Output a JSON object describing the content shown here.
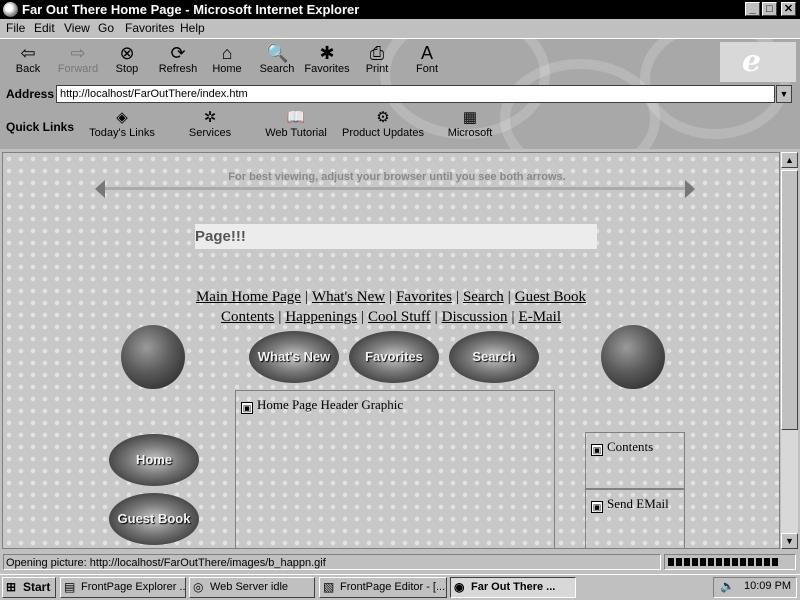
{
  "window": {
    "title": "Far Out There Home Page - Microsoft Internet Explorer",
    "controls": {
      "minimize": "_",
      "maximize": "□",
      "close": "✕"
    }
  },
  "menu": [
    "File",
    "Edit",
    "View",
    "Go",
    "Favorites",
    "Help"
  ],
  "toolbar": {
    "buttons": [
      {
        "label": "Back",
        "icon": "⇦"
      },
      {
        "label": "Forward",
        "icon": "⇨"
      },
      {
        "label": "Stop",
        "icon": "⊗"
      },
      {
        "label": "Refresh",
        "icon": "⟳"
      },
      {
        "label": "Home",
        "icon": "⌂"
      },
      {
        "label": "Search",
        "icon": "🔍"
      },
      {
        "label": "Favorites",
        "icon": "✱"
      },
      {
        "label": "Print",
        "icon": "⎙"
      },
      {
        "label": "Font",
        "icon": "A"
      }
    ],
    "logo": "e"
  },
  "address": {
    "label": "Address",
    "value": "http://localhost/FarOutThere/index.htm",
    "dropdown": "▼"
  },
  "quick_links": {
    "label": "Quick Links",
    "items": [
      {
        "label": "Today's Links",
        "icon": "◈"
      },
      {
        "label": "Services",
        "icon": "✲"
      },
      {
        "label": "Web Tutorial",
        "icon": "📖"
      },
      {
        "label": "Product Updates",
        "icon": "⚙"
      },
      {
        "label": "Microsoft",
        "icon": "▦"
      }
    ]
  },
  "page": {
    "best_view": "For best viewing, adjust your browser until you see both arrows.",
    "banner": "Page!!!",
    "nav_row1": [
      "Main Home Page",
      "What's New",
      "Favorites",
      "Search",
      "Guest Book"
    ],
    "nav_row2": [
      "Contents",
      "Happenings",
      "Cool Stuff",
      "Discussion",
      "E-Mail"
    ],
    "separator": "|",
    "oval_buttons": [
      "What's New",
      "Favorites",
      "Search"
    ],
    "left_buttons": [
      "Home",
      "Guest Book"
    ],
    "header_graphic": "Home Page Header Graphic",
    "side_images": [
      "Contents",
      "Send EMail"
    ],
    "broken_icon": "▣"
  },
  "scrollbar": {
    "up": "▲",
    "down": "▼"
  },
  "status": {
    "text": "Opening picture: http://localhost/FarOutThere/images/b_happn.gif",
    "progress": 0.9
  },
  "taskbar": {
    "start": "Start",
    "tasks": [
      {
        "label": "FrontPage Explorer ...",
        "icon": "▤"
      },
      {
        "label": "Web Server idle",
        "icon": "◎"
      },
      {
        "label": "FrontPage Editor - [...",
        "icon": "▧"
      },
      {
        "label": "Far Out There ...",
        "icon": "◉"
      }
    ],
    "clock": "10:09 PM",
    "speaker": "🔈"
  }
}
